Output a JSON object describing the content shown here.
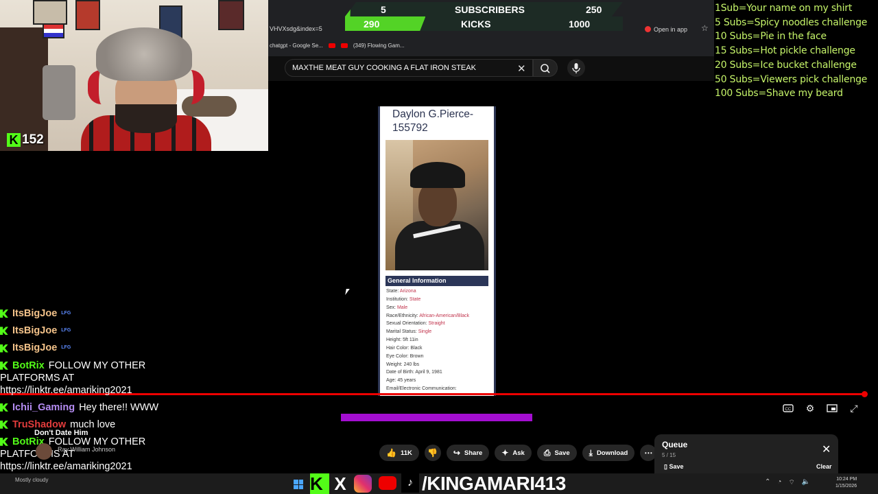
{
  "goal": {
    "subs_current": "5",
    "subs_label": "SUBSCRIBERS",
    "subs_target": "250",
    "kicks_current": "290",
    "kicks_label": "KICKS",
    "kicks_target": "1000",
    "subs_progress": 0.02,
    "kicks_progress": 0.29
  },
  "webcam": {
    "viewer_count": "152"
  },
  "browser": {
    "url": "VHVXsdg&index=5",
    "open_in_app": "Open in app",
    "bookmarks": [
      "chatgpt - Google Se...",
      "(349) Flowing Gam..."
    ]
  },
  "youtube": {
    "search_query": "MAXTHE MEAT GUY COOKING A FLAT IRON STEAK",
    "actions": {
      "likes": "11K",
      "share": "Share",
      "ask": "Ask",
      "save": "Save",
      "download": "Download"
    },
    "channel_title": "Don't Date Him",
    "channel_owner": "Ray William Johnson"
  },
  "rules": [
    "1Sub=Your name on my shirt",
    "5 Subs=Spicy noodles challenge",
    "10 Subs=Pie in the face",
    "15 Subs=Hot pickle challenge",
    "20 Subs=Ice bucket challenge",
    "50 Subs=Viewers pick challenge",
    "100 Subs=Shave my beard"
  ],
  "record": {
    "name": "Daylon G.Pierce-155792",
    "section_title": "General Information",
    "fields": [
      {
        "label": "State:",
        "value": "Arizona",
        "accent": true
      },
      {
        "label": "Institution:",
        "value": "State",
        "accent": true
      },
      {
        "label": "Sex:",
        "value": "Male",
        "accent": true
      },
      {
        "label": "Race/Ethnicity:",
        "value": "African-American/Black",
        "accent": true
      },
      {
        "label": "Sexual Orientation:",
        "value": "Straight",
        "accent": true
      },
      {
        "label": "Marital Status:",
        "value": "Single",
        "accent": true
      },
      {
        "label": "Height:",
        "value": "5ft 11in",
        "accent": false
      },
      {
        "label": "Hair Color:",
        "value": "Black",
        "accent": false
      },
      {
        "label": "Eye Color:",
        "value": "Brown",
        "accent": false
      },
      {
        "label": "Weight:",
        "value": "240 lbs",
        "accent": false
      },
      {
        "label": "Date of Birth:",
        "value": "April 9, 1981",
        "accent": false
      },
      {
        "label": "Age:",
        "value": "45 years",
        "accent": false
      },
      {
        "label": "Email/Electronic Communication:",
        "value": "",
        "accent": false
      }
    ]
  },
  "chat": [
    {
      "user": "ItsBigJoe",
      "badge": "LFG",
      "text": "",
      "color": "#f4c38a"
    },
    {
      "user": "ItsBigJoe",
      "badge": "LFG",
      "text": "",
      "color": "#f4c38a"
    },
    {
      "user": "ItsBigJoe",
      "badge": "LFG",
      "text": "",
      "color": "#f4c38a"
    },
    {
      "user": "BotRix",
      "badge": "",
      "text": "FOLLOW MY OTHER PLATFORMS AT https://linktr.ee/amariking2021",
      "color": "#53fc18"
    },
    {
      "user": "Ichii_Gaming",
      "badge": "",
      "text": "Hey there!! WWW",
      "color": "#b58cf2"
    },
    {
      "user": "TruShadow",
      "badge": "",
      "text": "much love",
      "color": "#e23c3c"
    },
    {
      "user": "BotRix",
      "badge": "",
      "text": "FOLLOW MY OTHER PLATFORMS AT https://linktr.ee/amariking2021",
      "color": "#53fc18"
    }
  ],
  "queue": {
    "title": "Queue",
    "position": "5 / 15",
    "save": "Save",
    "clear": "Clear"
  },
  "taskbar": {
    "weather": "Mostly cloudy",
    "handle": "/KINGAMARI413",
    "time": "10:24 PM",
    "date": "1/15/2026"
  },
  "colors": {
    "kick_green": "#53fc18",
    "yt_red": "#ff0000",
    "rules_text": "#c6f56a",
    "accent_purple": "#a40ed1"
  }
}
